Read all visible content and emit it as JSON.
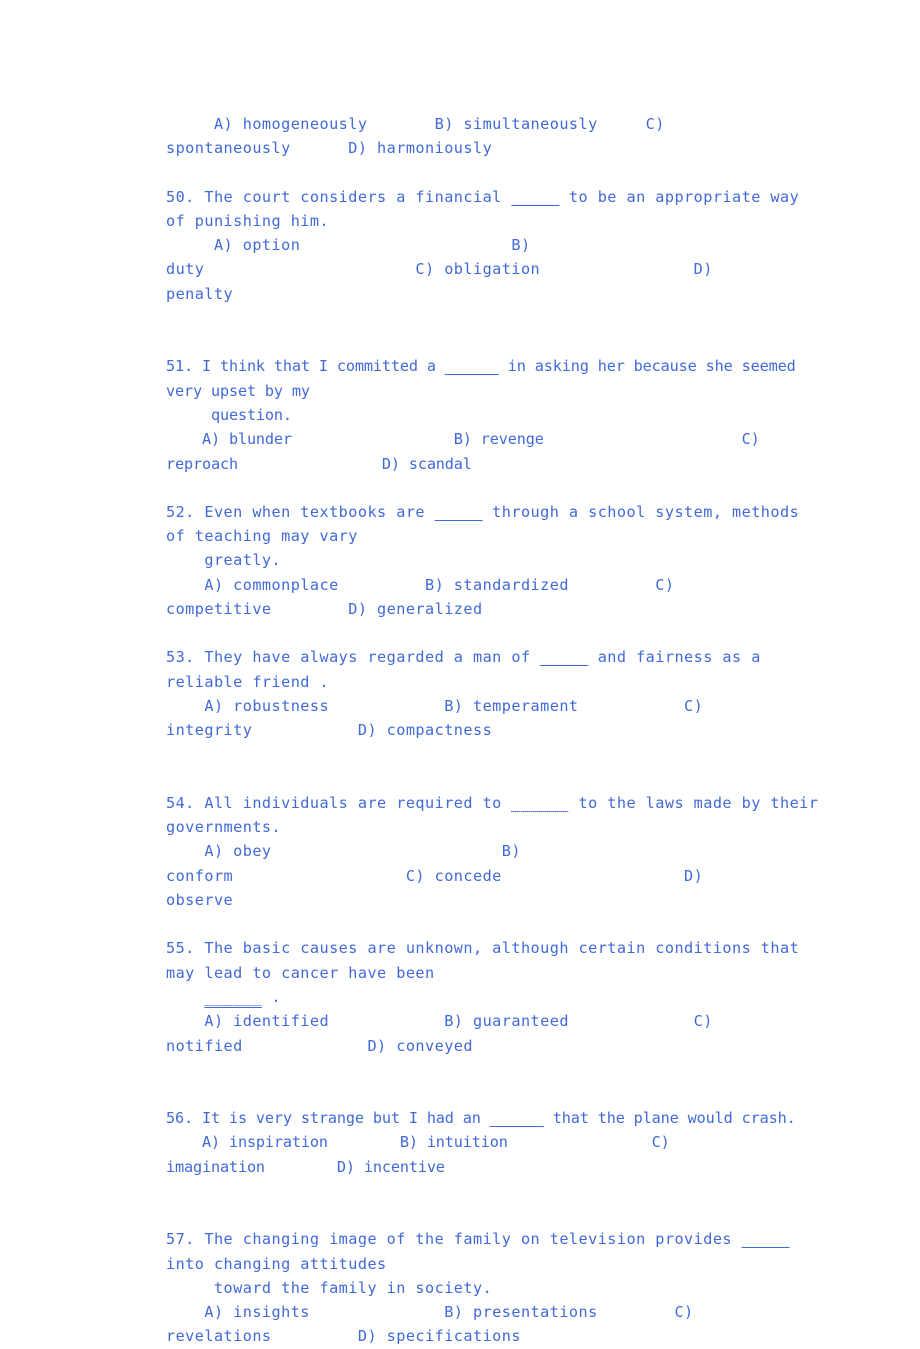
{
  "document": {
    "type": "vocabulary-multiple-choice-exercise",
    "text_color": "#4169d8",
    "background_color": "#ffffff"
  },
  "blocks": [
    {
      "id": "q49-options",
      "lines": [
        {
          "text": "     A) homogeneously       B) simultaneously     C)"
        },
        {
          "text": "spontaneously      D) harmoniously"
        }
      ]
    },
    {
      "id": "q50",
      "number": "50.",
      "lines": [
        {
          "pre": "50. The court considers a financial ",
          "blank": "_____",
          "post": " to be an appropriate way"
        },
        {
          "text": "of punishing him."
        },
        {
          "text": "     A) option                      B)"
        },
        {
          "text": "duty                      C) obligation                D)"
        },
        {
          "text": "penalty"
        }
      ]
    },
    {
      "id": "gap-1",
      "spacer": true
    },
    {
      "id": "q51",
      "number": "51.",
      "tight": true,
      "lines": [
        {
          "pre": "51. I think that I committed a ",
          "blank": "______",
          "post": " in asking her because she seemed",
          "tight": true
        },
        {
          "text": "very upset by my"
        },
        {
          "text": "     question."
        },
        {
          "text": "    A) blunder                  B) revenge                      C)"
        },
        {
          "text": "reproach                D) scandal"
        }
      ]
    },
    {
      "id": "q52",
      "number": "52.",
      "lines": [
        {
          "pre": "52. Even when textbooks are ",
          "blank": "_____",
          "post": " through a school system, methods"
        },
        {
          "text": "of teaching may vary"
        },
        {
          "text": "    greatly."
        },
        {
          "text": "    A) commonplace         B) standardized         C)"
        },
        {
          "text": "competitive        D) generalized"
        }
      ]
    },
    {
      "id": "q53",
      "number": "53.",
      "lines": [
        {
          "pre": "53. They have always regarded a man of ",
          "blank": "_____",
          "post": " and fairness as a"
        },
        {
          "text": "reliable friend ."
        },
        {
          "text": "    A) robustness            B) temperament           C)"
        },
        {
          "text": "integrity           D) compactness"
        }
      ]
    },
    {
      "id": "gap-2",
      "spacer": true
    },
    {
      "id": "q54",
      "number": "54.",
      "lines": [
        {
          "pre": "54. All individuals are required to ",
          "blank": "______",
          "blank_style": "faint",
          "post": " to the laws made by their"
        },
        {
          "text": "governments."
        },
        {
          "text": "    A) obey                        B)"
        },
        {
          "text": "conform                  C) concede                   D)"
        },
        {
          "text": "observe"
        }
      ]
    },
    {
      "id": "q55",
      "number": "55.",
      "lines": [
        {
          "text": "55. The basic causes are unknown, although certain conditions that"
        },
        {
          "text": "may lead to cancer have been"
        },
        {
          "pre": "    ",
          "blank": "______",
          "blank_style": "raised",
          "post": " ."
        },
        {
          "text": "    A) identified            B) guaranteed             C)"
        },
        {
          "text": "notified             D) conveyed"
        }
      ]
    },
    {
      "id": "gap-3",
      "spacer": true
    },
    {
      "id": "q56",
      "number": "56.",
      "tight": true,
      "lines": [
        {
          "pre": "56. It is very strange but I had an ",
          "blank": "______",
          "post": " that the plane would crash.",
          "tight": true
        },
        {
          "text": "    A) inspiration        B) intuition                C)"
        },
        {
          "text": "imagination        D) incentive"
        }
      ]
    },
    {
      "id": "gap-4",
      "spacer": true
    },
    {
      "id": "q57",
      "number": "57.",
      "lines": [
        {
          "pre": "57. The changing image of the family on television provides ",
          "blank": "_____",
          "post": ""
        },
        {
          "text": "into changing attitudes"
        },
        {
          "text": "     toward the family in society."
        },
        {
          "text": "    A) insights              B) presentations        C)"
        },
        {
          "text": "revelations         D) specifications"
        }
      ]
    }
  ]
}
